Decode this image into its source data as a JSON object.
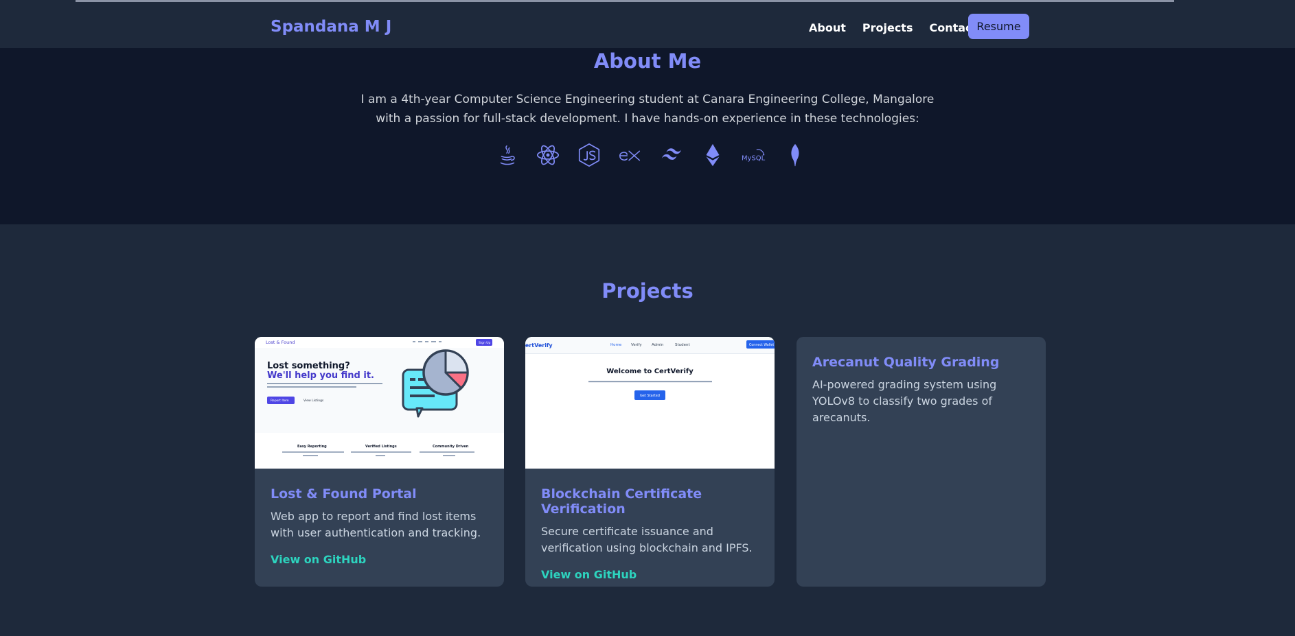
{
  "header": {
    "brand": "Spandana M J",
    "nav": [
      "About",
      "Projects",
      "Contact"
    ],
    "resume_label": "Resume"
  },
  "about": {
    "title": "About Me",
    "text": "I am a 4th-year Computer Science Engineering student at Canara Engineering College, Mangalore with a passion for full-stack development. I have hands-on experience in these technologies:",
    "tech_icons": [
      "java-icon",
      "react-icon",
      "nodejs-icon",
      "express-icon",
      "tailwind-icon",
      "ethereum-icon",
      "mysql-icon",
      "mongodb-icon"
    ],
    "mysql_text": "MySQL"
  },
  "projects": {
    "title": "Projects",
    "items": [
      {
        "title": "Lost & Found Portal",
        "description": "Web app to report and find lost items with user authentication and tracking.",
        "link": "View on GitHub",
        "screenshot": {
          "brand": "Lost & Found",
          "button": "Sign Up",
          "headline_a": "Lost something?",
          "headline_b": "We'll help you find it.",
          "cta_primary": "Report Item",
          "cta_secondary": "View Listings",
          "features": [
            "Easy Reporting",
            "Verified Listings",
            "Community Driven"
          ]
        }
      },
      {
        "title": "Blockchain Certificate Verification",
        "description": "Secure certificate issuance and verification using blockchain and IPFS.",
        "link": "View on GitHub",
        "screenshot": {
          "brand": "CertVerify",
          "nav": [
            "Home",
            "Verify",
            "Admin",
            "Student"
          ],
          "button": "Connect Wallet",
          "heading": "Welcome to CertVerify",
          "cta": "Get Started"
        }
      },
      {
        "title": "Arecanut Quality Grading",
        "description": "AI-powered grading system using YOLOv8 to classify two grades of arecanuts."
      }
    ]
  },
  "colors": {
    "accent": "#818cf8",
    "link": "#2dd4bf",
    "page_bg": "#1e293b",
    "about_bg": "#0f172a",
    "card_bg": "#334155"
  }
}
